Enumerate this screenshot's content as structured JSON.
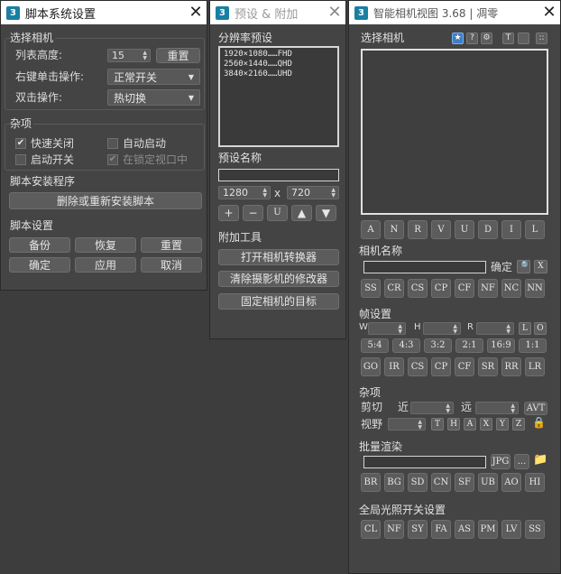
{
  "win1": {
    "title": "脚本系统设置",
    "sec_camera": "选择相机",
    "list_height_label": "列表高度:",
    "list_height_value": "15",
    "reset_btn": "重置",
    "right_click_label": "右键单击操作:",
    "right_click_value": "正常开关",
    "dbl_click_label": "双击操作:",
    "dbl_click_value": "热切换",
    "sec_misc": "杂项",
    "cb_quick_close": "快速关闭",
    "cb_auto_start": "自动启动",
    "cb_start_switch": "启动开关",
    "cb_in_locked_view": "在锁定视口中",
    "sec_installer": "脚本安装程序",
    "reinstall_btn": "删除或重新安装脚本",
    "sec_script_settings": "脚本设置",
    "backup_btn": "备份",
    "restore_btn": "恢复",
    "reset2_btn": "重置",
    "ok_btn": "确定",
    "apply_btn": "应用",
    "cancel_btn": "取消"
  },
  "win2": {
    "title": "预设 & 附加",
    "sec_resolution": "分辨率预设",
    "presets": [
      "1920×1080……FHD",
      "2560×1440……QHD",
      "3840×2160……UHD"
    ],
    "sec_preset_name": "预设名称",
    "width_value": "1280",
    "x_sep": "x",
    "height_value": "720",
    "btn_plus": "+",
    "btn_minus": "−",
    "btn_u": "U",
    "btn_up": "▲",
    "btn_down": "▼",
    "sec_tools": "附加工具",
    "open_converter_btn": "打开相机转换器",
    "clear_camera_mods_btn": "清除摄影机的修改器",
    "fix_target_btn": "固定相机的目标"
  },
  "win3": {
    "title": "智能相机视图 3.68 | 凋零",
    "sec_select_camera": "选择相机",
    "top_icons": [
      "★",
      "?",
      "⚙",
      "T",
      "",
      "::"
    ],
    "filter_buttons": [
      "A",
      "N",
      "R",
      "V",
      "U",
      "D",
      "I",
      "L"
    ],
    "sec_camera_name": "相机名称",
    "confirm_label": "确定",
    "search_icon_glyph": "🔎",
    "x_btn": "X",
    "name_buttons": [
      "SS",
      "CR",
      "CS",
      "CP",
      "CF",
      "NF",
      "NC",
      "NN"
    ],
    "sec_frame": "帧设置",
    "w_label": "W",
    "h_label": "H",
    "r_label": "R",
    "l_btn": "L",
    "o_btn": "O",
    "ratio_buttons": [
      "5:4",
      "4:3",
      "3:2",
      "2:1",
      "16:9",
      "1:1"
    ],
    "frame_buttons": [
      "GO",
      "IR",
      "CS",
      "CP",
      "CF",
      "SR",
      "RR",
      "LR"
    ],
    "sec_misc": "杂项",
    "clip_label": "剪切",
    "near_label": "近",
    "far_label": "远",
    "avt_btn": "AVT",
    "fov_label": "视野",
    "axis_buttons": [
      "T",
      "H",
      "A",
      "X",
      "Y",
      "Z"
    ],
    "lock_icon_glyph": "🔒",
    "sec_batch": "批量渲染",
    "jpg_btn": "JPG",
    "dots_btn": "...",
    "folder_icon_glyph": "📁",
    "batch_buttons": [
      "BR",
      "BG",
      "SD",
      "CN",
      "SF",
      "UB",
      "AO",
      "HI"
    ],
    "sec_gi": "全局光照开关设置",
    "gi_buttons": [
      "CL",
      "NF",
      "SY",
      "FA",
      "AS",
      "PM",
      "LV",
      "SS"
    ]
  }
}
